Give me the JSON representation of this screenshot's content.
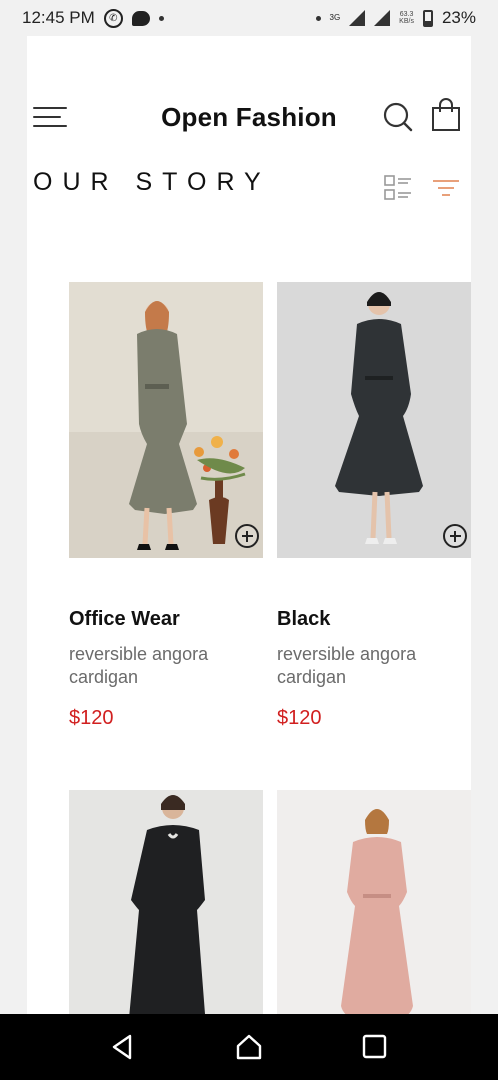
{
  "status_bar": {
    "time": "12:45 PM",
    "network": "3G",
    "speed_value": "63.3",
    "speed_unit": "KB/s",
    "battery": "23%"
  },
  "header": {
    "title": "Open Fashion"
  },
  "section": {
    "title": "OUR STORY"
  },
  "colors": {
    "accent": "#e8a07a",
    "price": "#d11f1f"
  },
  "products": [
    {
      "name": "Office Wear",
      "desc": "reversible angora cardigan",
      "price": "$120"
    },
    {
      "name": "Black",
      "desc": "reversible angora cardigan",
      "price": "$120"
    },
    {
      "name": "",
      "desc": "",
      "price": ""
    },
    {
      "name": "",
      "desc": "",
      "price": ""
    }
  ]
}
